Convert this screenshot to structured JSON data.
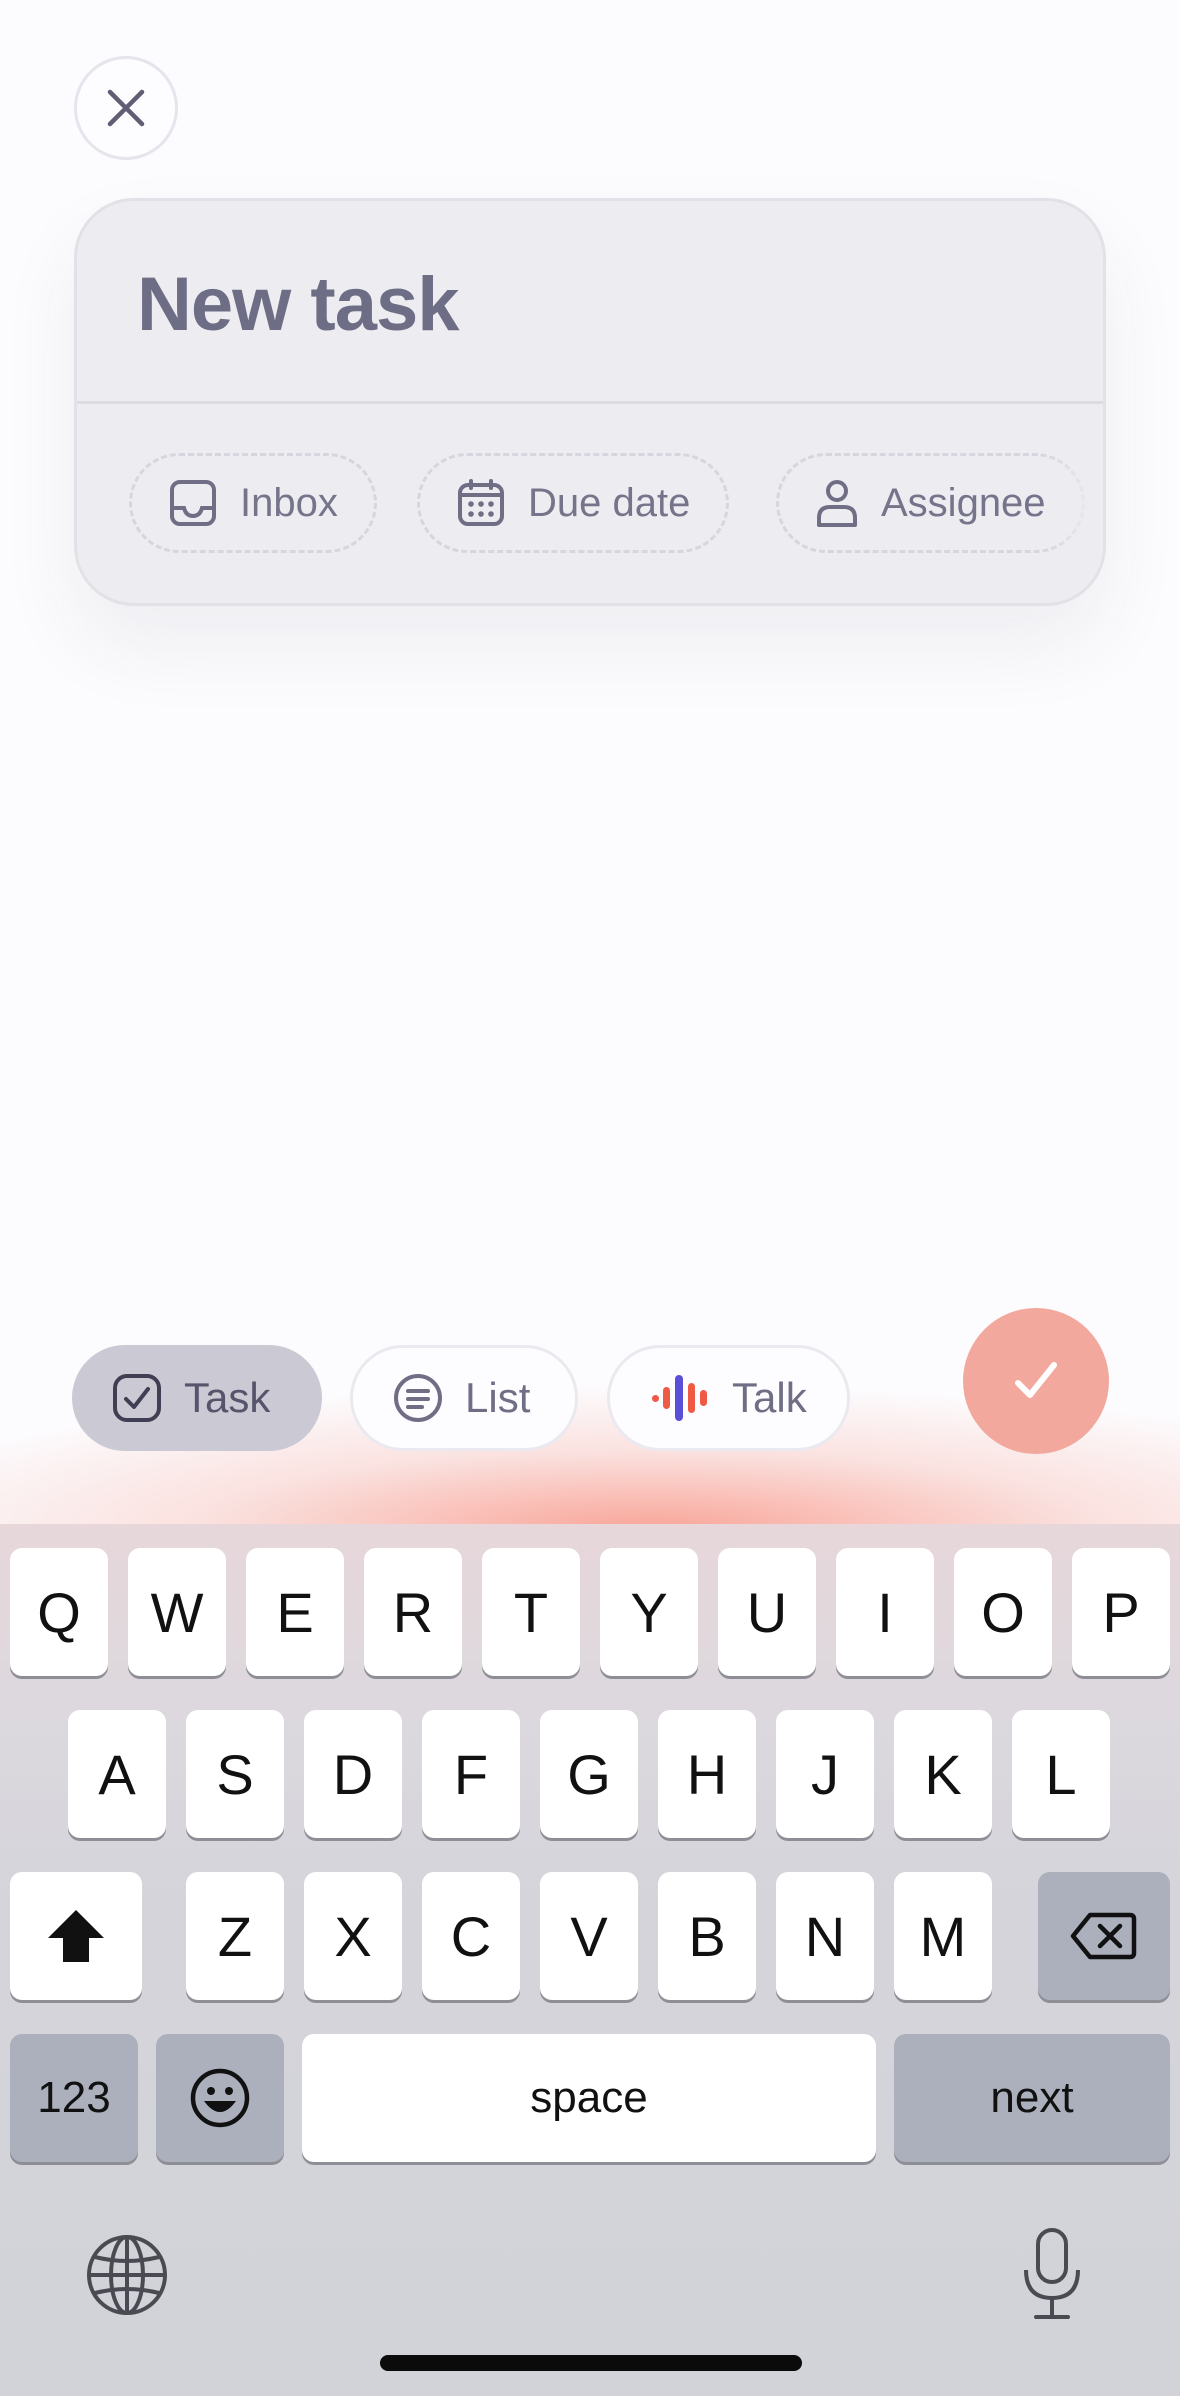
{
  "screen": {
    "task_title": "New task",
    "chips": [
      {
        "label": "Inbox",
        "icon": "inbox-icon"
      },
      {
        "label": "Due date",
        "icon": "calendar-icon"
      },
      {
        "label": "Assignee",
        "icon": "person-icon"
      }
    ],
    "modes": [
      {
        "label": "Task",
        "icon": "checkbox-icon",
        "active": true
      },
      {
        "label": "List",
        "icon": "list-icon",
        "active": false
      },
      {
        "label": "Talk",
        "icon": "voice-wave-icon",
        "active": false
      }
    ],
    "accent_color": "#f3a89e"
  },
  "keyboard": {
    "row1": [
      "Q",
      "W",
      "E",
      "R",
      "T",
      "Y",
      "U",
      "I",
      "O",
      "P"
    ],
    "row2": [
      "A",
      "S",
      "D",
      "F",
      "G",
      "H",
      "J",
      "K",
      "L"
    ],
    "row3": [
      "Z",
      "X",
      "C",
      "V",
      "B",
      "N",
      "M"
    ],
    "numbers_key": "123",
    "space_key": "space",
    "return_key": "next"
  }
}
